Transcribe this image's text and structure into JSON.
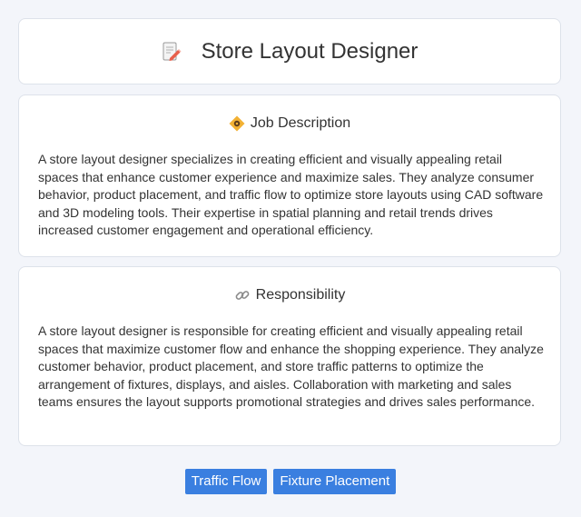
{
  "header": {
    "title": "Store Layout Designer",
    "icon": "memo-pencil-icon"
  },
  "job_description": {
    "title": "Job Description",
    "icon": "diamond-badge-icon",
    "body": "A store layout designer specializes in creating efficient and visually appealing retail spaces that enhance customer experience and maximize sales. They analyze consumer behavior, product placement, and traffic flow to optimize store layouts using CAD software and 3D modeling tools. Their expertise in spatial planning and retail trends drives increased customer engagement and operational efficiency."
  },
  "responsibility": {
    "title": "Responsibility",
    "icon": "link-icon",
    "body": "A store layout designer is responsible for creating efficient and visually appealing retail spaces that maximize customer flow and enhance the shopping experience. They analyze customer behavior, product placement, and store traffic patterns to optimize the arrangement of fixtures, displays, and aisles. Collaboration with marketing and sales teams ensures the layout supports promotional strategies and drives sales performance."
  },
  "tags": [
    "Traffic Flow",
    "Fixture Placement"
  ],
  "colors": {
    "tag_bg": "#3a7fe0",
    "page_bg": "#f3f5fa"
  }
}
